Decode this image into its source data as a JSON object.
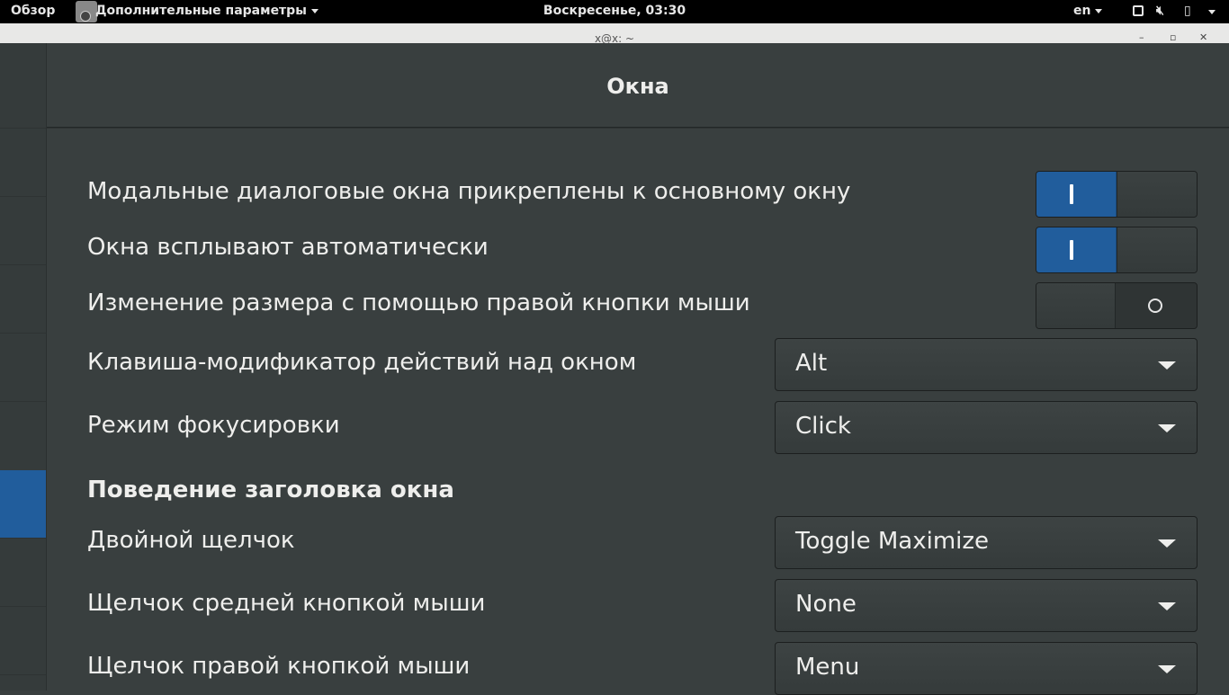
{
  "topbar": {
    "activities": "Обзор",
    "app_menu": "Дополнительные параметры",
    "clock": "Воскресенье, 03:30",
    "language": "en"
  },
  "terminal": {
    "title": "x@x: ~",
    "min": "–",
    "max": "▫",
    "close": "✕"
  },
  "header": {
    "title": "Окна"
  },
  "settings": {
    "attach_modal": {
      "label": "Модальные диалоговые окна прикреплены к основному окну",
      "state": "on"
    },
    "auto_raise": {
      "label": "Окна всплывают автоматически",
      "state": "on"
    },
    "resize_secondary": {
      "label": "Изменение размера с помощью правой кнопки мыши",
      "state": "off"
    },
    "action_key": {
      "label": "Клавиша-модификатор действий над окном",
      "value": "Alt"
    },
    "focus_mode": {
      "label": "Режим фокусировки",
      "value": "Click"
    },
    "titlebar_section": "Поведение заголовка окна",
    "double_click": {
      "label": "Двойной щелчок",
      "value": "Toggle Maximize"
    },
    "middle_click": {
      "label": "Щелчок средней кнопкой мыши",
      "value": "None"
    },
    "right_click": {
      "label": "Щелчок правой кнопкой мыши",
      "value": "Menu"
    }
  },
  "colors": {
    "accent": "#215d9c",
    "background": "#393f3f",
    "topbar": "#000000"
  }
}
